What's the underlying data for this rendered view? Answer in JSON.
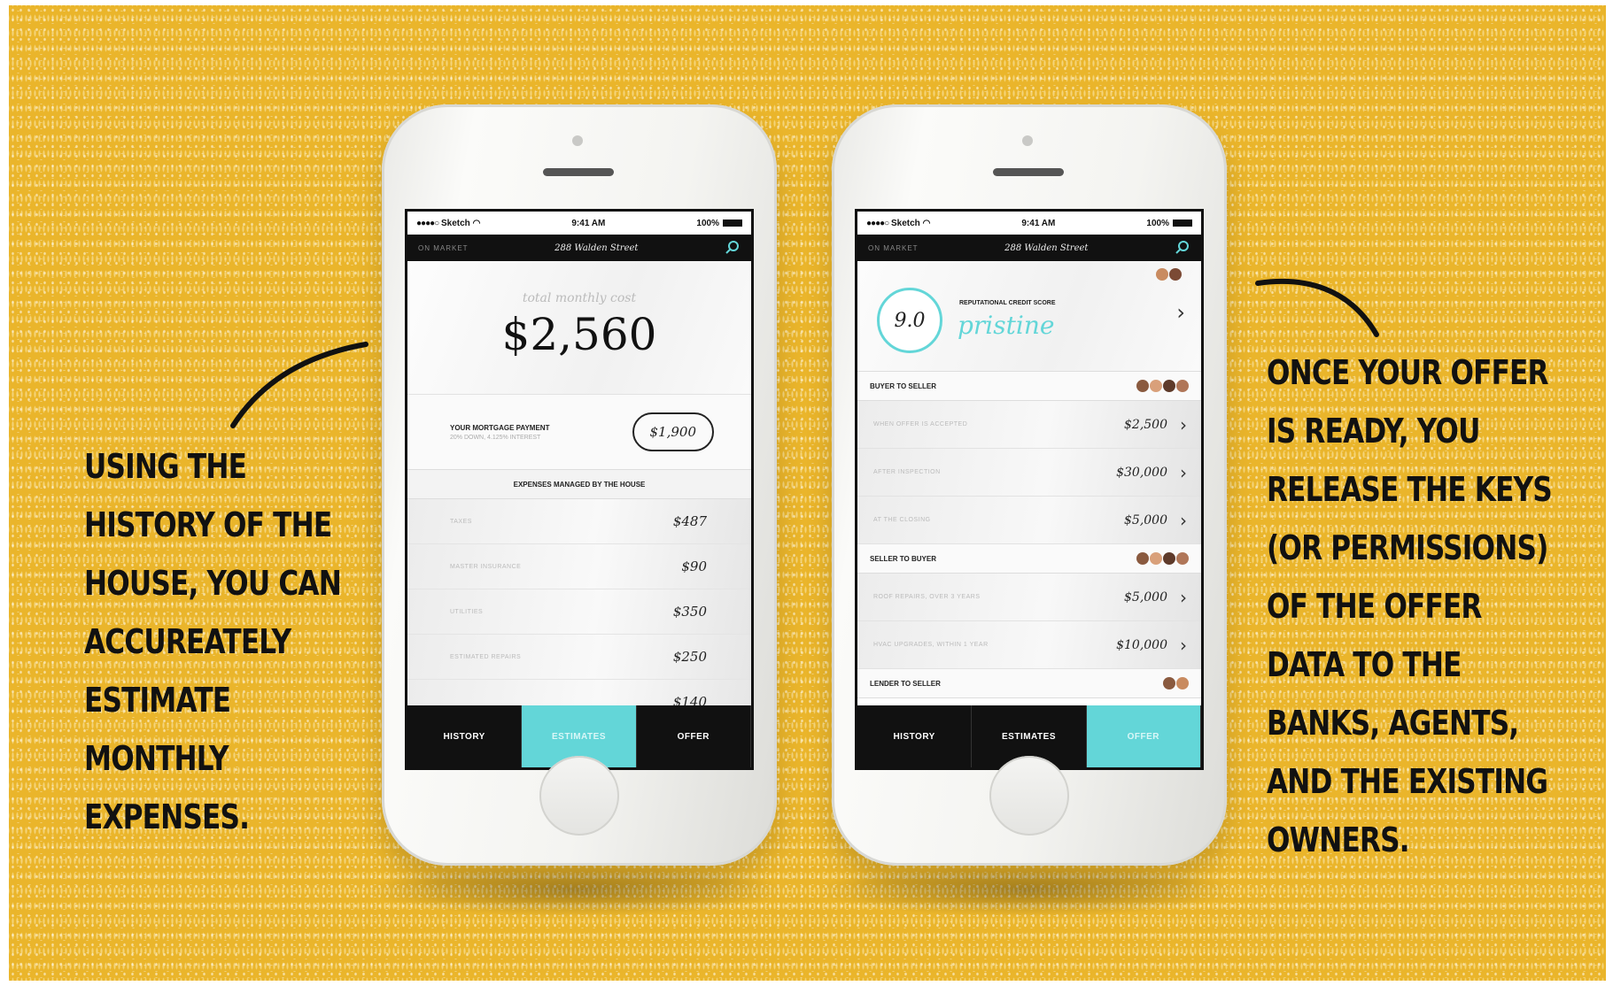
{
  "captions": {
    "left": [
      "USING THE",
      "HISTORY OF THE",
      "HOUSE, YOU CAN",
      "ACCUREATELY",
      "ESTIMATE",
      "MONTHLY",
      "EXPENSES."
    ],
    "right": [
      "ONCE YOUR OFFER",
      "IS READY, YOU",
      "RELEASE THE KEYS",
      "(OR PERMISSIONS)",
      "OF THE OFFER",
      "DATA TO THE",
      "BANKS, AGENTS,",
      "AND THE EXISTING",
      "OWNERS."
    ]
  },
  "status_bar": {
    "carrier": "Sketch",
    "signal": "●●●●○",
    "time": "9:41 AM",
    "battery": "100%"
  },
  "nav": {
    "left": "ON MARKET",
    "title": "288 Walden Street"
  },
  "tabs": [
    "HISTORY",
    "ESTIMATES",
    "OFFER"
  ],
  "estimates_screen": {
    "cost_label": "total monthly cost",
    "cost_value": "$2,560",
    "mortgage_title": "YOUR MORTGAGE PAYMENT",
    "mortgage_sub": "20% DOWN, 4.125% INTEREST",
    "mortgage_value": "$1,900",
    "section_title": "EXPENSES MANAGED BY THE HOUSE",
    "expenses": [
      {
        "label": "TAXES",
        "value": "$487"
      },
      {
        "label": "MASTER INSURANCE",
        "value": "$90"
      },
      {
        "label": "UTILITIES",
        "value": "$350"
      },
      {
        "label": "ESTIMATED REPAIRS",
        "value": "$250"
      }
    ],
    "partial_value": "$140"
  },
  "offer_screen": {
    "score": "9.0",
    "score_label": "REPUTATIONAL CREDIT SCORE",
    "score_word": "pristine",
    "groups": [
      {
        "title": "BUYER TO SELLER",
        "rows": [
          {
            "label": "WHEN OFFER IS ACCEPTED",
            "value": "$2,500"
          },
          {
            "label": "AFTER INSPECTION",
            "value": "$30,000"
          },
          {
            "label": "AT THE CLOSING",
            "value": "$5,000"
          }
        ]
      },
      {
        "title": "SELLER TO BUYER",
        "rows": [
          {
            "label": "ROOF REPAIRS, OVER 3 YEARS",
            "value": "$5,000"
          },
          {
            "label": "HVAC UPGRADES, WITHIN 1 YEAR",
            "value": "$10,000"
          }
        ]
      },
      {
        "title": "LENDER TO SELLER",
        "rows": []
      }
    ]
  },
  "icons": {
    "search": "search-icon",
    "chevron": "chevron-right-icon",
    "wifi": "wifi-icon"
  },
  "colors": {
    "background": "#eab52b",
    "accent": "#63d6d8",
    "bar": "#111111"
  }
}
